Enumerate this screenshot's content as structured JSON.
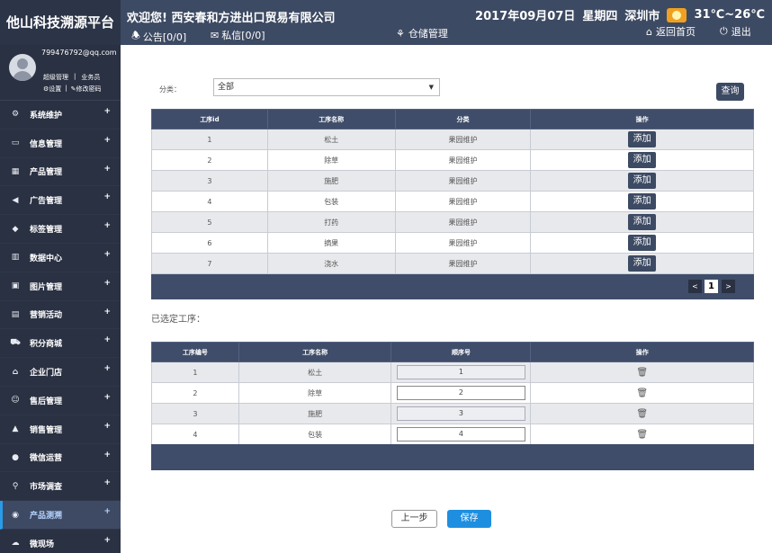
{
  "brand": "他山科技溯源平台",
  "header": {
    "welcome": "欢迎您! 西安春和方进出口贸易有限公司",
    "notice": "公告[0/0]",
    "message": "私信[0/0]",
    "module": "仓储管理",
    "date": "2017年09月07日",
    "weekday": "星期四",
    "city": "深圳市",
    "temperature": "31℃~26℃",
    "home": "返回首页",
    "logout": "退出"
  },
  "user": {
    "email": "799476792@qq.com",
    "role1": "超级管理",
    "role2": "业务员",
    "settings": "设置",
    "change_password": "修改密码"
  },
  "nav": [
    {
      "label": "系统维护",
      "icon": "gear-icon"
    },
    {
      "label": "信息管理",
      "icon": "id-card-icon"
    },
    {
      "label": "产品管理",
      "icon": "grid-icon"
    },
    {
      "label": "广告管理",
      "icon": "megaphone-icon"
    },
    {
      "label": "标签管理",
      "icon": "tag-icon"
    },
    {
      "label": "数据中心",
      "icon": "bar-chart-icon"
    },
    {
      "label": "图片管理",
      "icon": "image-icon"
    },
    {
      "label": "营销活动",
      "icon": "gift-icon"
    },
    {
      "label": "积分商城",
      "icon": "cart-icon"
    },
    {
      "label": "企业门店",
      "icon": "store-icon"
    },
    {
      "label": "售后管理",
      "icon": "users-icon"
    },
    {
      "label": "销售管理",
      "icon": "sales-icon"
    },
    {
      "label": "微信运营",
      "icon": "wechat-icon"
    },
    {
      "label": "市场调查",
      "icon": "search-icon"
    },
    {
      "label": "产品测溯",
      "icon": "globe-icon",
      "active": true
    },
    {
      "label": "微现场",
      "icon": "cloud-icon"
    }
  ],
  "filter": {
    "label": "分类：",
    "selected": "全部",
    "query_button": "查询"
  },
  "process_table": {
    "headers": [
      "工序id",
      "工序名称",
      "分类",
      "操作"
    ],
    "action_label": "添加",
    "rows": [
      {
        "id": "1",
        "name": "松土",
        "category": "果园维护"
      },
      {
        "id": "2",
        "name": "除草",
        "category": "果园维护"
      },
      {
        "id": "3",
        "name": "施肥",
        "category": "果园维护"
      },
      {
        "id": "4",
        "name": "包装",
        "category": "果园维护"
      },
      {
        "id": "5",
        "name": "打药",
        "category": "果园维护"
      },
      {
        "id": "6",
        "name": "摘果",
        "category": "果园维护"
      },
      {
        "id": "7",
        "name": "浇水",
        "category": "果园维护"
      }
    ]
  },
  "pager": {
    "prev": "<",
    "current": "1",
    "next": ">"
  },
  "selected_label": "已选定工序：",
  "selected_table": {
    "headers": [
      "工序编号",
      "工序名称",
      "顺序号",
      "操作"
    ],
    "rows": [
      {
        "no": "1",
        "name": "松土",
        "order": "1"
      },
      {
        "no": "2",
        "name": "除草",
        "order": "2"
      },
      {
        "no": "3",
        "name": "施肥",
        "order": "3"
      },
      {
        "no": "4",
        "name": "包装",
        "order": "4"
      }
    ]
  },
  "buttons": {
    "prev_step": "上一步",
    "save": "保存"
  },
  "colors": {
    "header": "#3d4a63",
    "sidebar": "#2a3142",
    "accent": "#1e8fe0"
  }
}
